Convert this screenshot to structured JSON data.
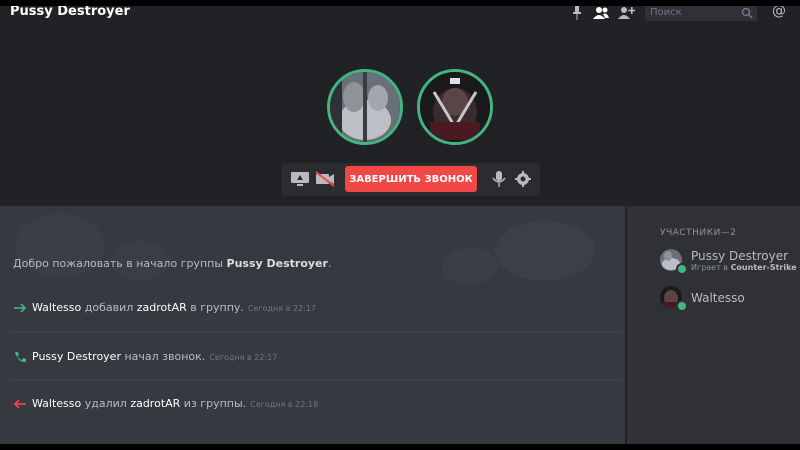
{
  "header": {
    "title": "Pussy Destroyer",
    "search_placeholder": "Поиск",
    "icons": [
      "pin-icon",
      "members-icon",
      "add-friend-icon",
      "search-icon",
      "mention-icon"
    ],
    "mention_glyph": "@"
  },
  "call": {
    "participants": [
      "Pussy Destroyer",
      "Waltesso"
    ],
    "end_call_label": "ЗАВЕРШИТЬ ЗВОНОК",
    "controls": [
      "screen-share-icon",
      "video-off-icon",
      "microphone-icon",
      "settings-icon"
    ]
  },
  "chat": {
    "welcome_prefix": "Добро пожаловать в начало группы ",
    "welcome_group": "Pussy Destroyer",
    "welcome_suffix": ".",
    "messages": [
      {
        "type": "join",
        "user": "Waltesso",
        "action": " добавил ",
        "target": "zadrotAR",
        "tail": " в группу.",
        "time": "Сегодня в 22:17"
      },
      {
        "type": "call",
        "user": "Pussy Destroyer",
        "action": " начал звонок.",
        "target": "",
        "tail": "",
        "time": "Сегодня в 22:17"
      },
      {
        "type": "leave",
        "user": "Waltesso",
        "action": " удалил ",
        "target": "zadrotAR",
        "tail": " из группы.",
        "time": "Сегодня в 22:18"
      }
    ]
  },
  "members": {
    "header": "УЧАСТНИКИ—2",
    "list": [
      {
        "name": "Pussy Destroyer",
        "activity_prefix": "Играет в ",
        "activity_game": "Counter-Strike Glo",
        "status": "online"
      },
      {
        "name": "Waltesso",
        "activity_prefix": "",
        "activity_game": "",
        "status": "online"
      }
    ]
  },
  "colors": {
    "accent_green": "#43b581",
    "danger_red": "#f04747",
    "background_dark": "#202225",
    "chat_bg": "#36393f",
    "sidebar_bg": "#2f3136"
  }
}
